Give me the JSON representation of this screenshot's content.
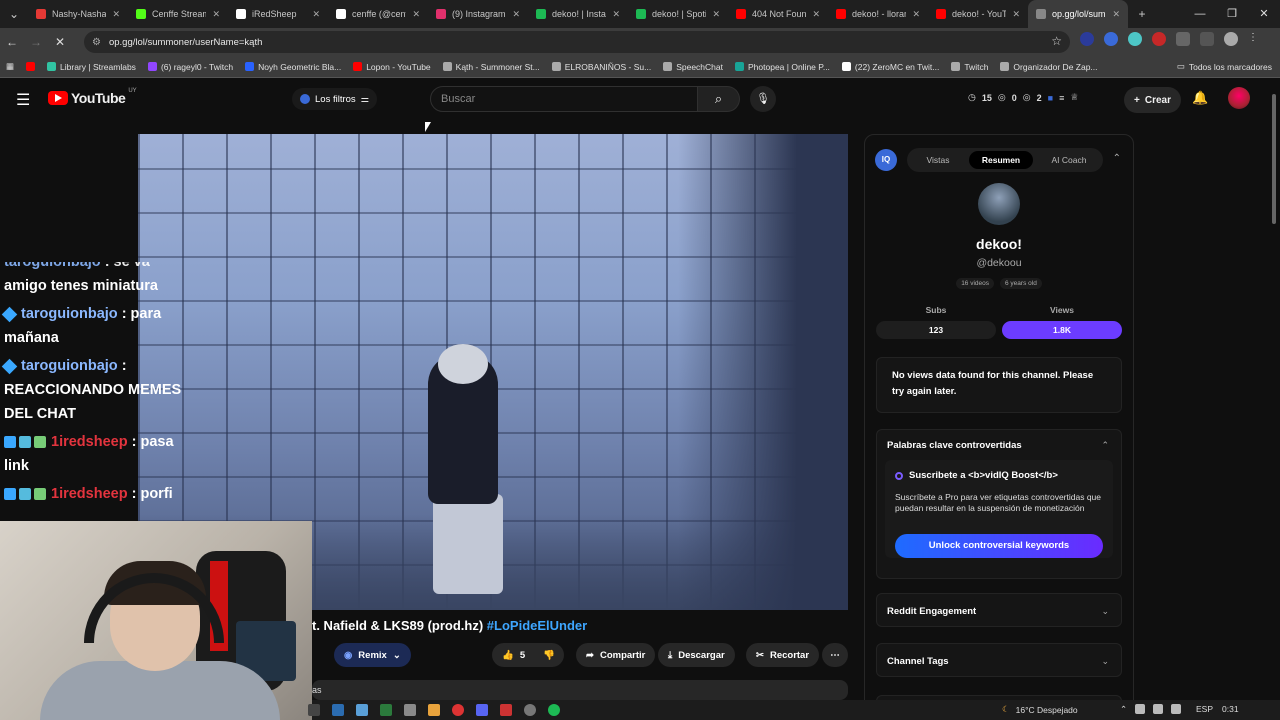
{
  "browser": {
    "tabs": [
      {
        "label": "Nashy-Nasha",
        "color": "#e53935"
      },
      {
        "label": "Cenffe Stream",
        "color": "#53fc18"
      },
      {
        "label": "iRedSheep",
        "color": "#ffffff"
      },
      {
        "label": "cenffe (@cenff",
        "color": "#ffffff"
      },
      {
        "label": "(9) Instagram",
        "color": "#e1306c"
      },
      {
        "label": "dekoo! | Instag",
        "color": "#1db954"
      },
      {
        "label": "dekoo! | Spotif",
        "color": "#1db954"
      },
      {
        "label": "404 Not Found",
        "color": "#ff0000"
      },
      {
        "label": "dekoo! - lloran",
        "color": "#ff0000"
      },
      {
        "label": "dekoo! - YouTu",
        "color": "#ff0000"
      },
      {
        "label": "op.gg/lol/sum",
        "color": "#888888"
      }
    ],
    "url": "op.gg/lol/summoner/userName=kąth",
    "bookmarks": [
      {
        "label": "Library | Streamlabs",
        "color": "#31c3a2"
      },
      {
        "label": "(6) rageyl0 - Twitch",
        "color": "#9146ff"
      },
      {
        "label": "Noyh Geometric Bla...",
        "color": "#2962ff"
      },
      {
        "label": "Lopon - YouTube",
        "color": "#ff0000"
      },
      {
        "label": "Kąth - Summoner St...",
        "color": "#aaaaaa"
      },
      {
        "label": "ELROBANIÑOS - Su...",
        "color": "#aaaaaa"
      },
      {
        "label": "SpeechChat",
        "color": "#aaaaaa"
      },
      {
        "label": "Photopea | Online P...",
        "color": "#18a497"
      },
      {
        "label": "(22) ZeroMC en Twit...",
        "color": "#ffffff"
      },
      {
        "label": "Twitch",
        "color": "#aaaaaa"
      },
      {
        "label": "Organizador De Zap...",
        "color": "#aaaaaa"
      }
    ],
    "all_bookmarks": "Todos los marcadores"
  },
  "youtube": {
    "logo_text": "YouTube",
    "country": "UY",
    "filters_label": "Los filtros",
    "search_placeholder": "Buscar",
    "stats": {
      "a": "15",
      "b": "0",
      "c": "2"
    },
    "create_label": "Crear"
  },
  "chat": [
    {
      "user": "taroguionbajo",
      "msg": ": se va",
      "partial": true
    },
    {
      "user": "",
      "msg": "amigo tenes miniatura"
    },
    {
      "user": "taroguionbajo",
      "msg": ": para mañana"
    },
    {
      "user": "taroguionbajo",
      "msg": ": REACCIONANDO MEMES DEL CHAT"
    },
    {
      "user": "1iredsheep",
      "msg": ": pasa link"
    },
    {
      "user": "1iredsheep",
      "msg": ": porfi"
    }
  ],
  "video": {
    "title": "t. Nafield & LKS89 (prod.hz)",
    "hashtag": "#LoPideElUnder",
    "remix": "Remix",
    "likes": "5",
    "share": "Compartir",
    "download": "Descargar",
    "clip": "Recortar",
    "desc_partial": "as"
  },
  "vidiq": {
    "badge": "IQ",
    "tabs": [
      "Vistas",
      "Resumen",
      "AI Coach"
    ],
    "active_tab": "Resumen",
    "channel_name": "dekoo!",
    "handle": "@dekoou",
    "videos_chip": "16 videos",
    "age_chip": "6 years old",
    "subs_label": "Subs",
    "subs_value": "123",
    "views_label": "Views",
    "views_value": "1.8K",
    "no_data": "No views data found for this channel. Please try again later.",
    "kw_title": "Palabras clave controvertidas",
    "boost_title": "Suscribete a <b>vidIQ Boost</b>",
    "boost_text": "Suscríbete a Pro para ver etiquetas controvertidas que puedan resultar en la suspensión de monetización",
    "unlock_label": "Unlock controversial keywords",
    "reddit": "Reddit Engagement",
    "tags": "Channel Tags"
  },
  "taskbar": {
    "weather": "16°C Despejado",
    "lang": "ESP",
    "time": "0:31"
  }
}
